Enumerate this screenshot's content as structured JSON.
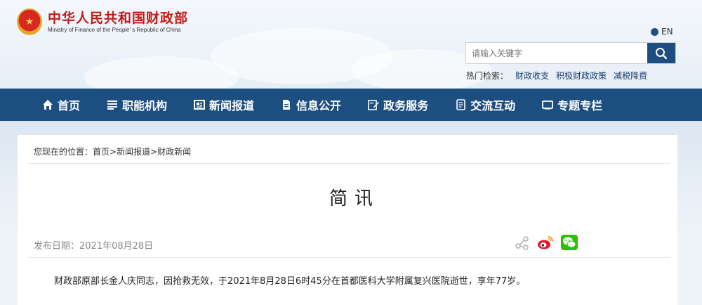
{
  "header": {
    "logo_cn": "中华人民共和国财政部",
    "logo_en": "Ministry of Finance of the People' s Republic of China",
    "lang_label": "EN",
    "search_placeholder": "请输入关键字",
    "hot_label": "热门检索：",
    "hot_links": [
      "财政收支",
      "积极财政政策",
      "减税降费"
    ]
  },
  "nav": {
    "items": [
      {
        "label": "首页",
        "icon": "home-icon"
      },
      {
        "label": "职能机构",
        "icon": "list-icon"
      },
      {
        "label": "新闻报道",
        "icon": "newspaper-icon"
      },
      {
        "label": "信息公开",
        "icon": "document-icon"
      },
      {
        "label": "政务服务",
        "icon": "edit-icon"
      },
      {
        "label": "交流互动",
        "icon": "notes-icon"
      },
      {
        "label": "专题专栏",
        "icon": "window-icon"
      }
    ]
  },
  "breadcrumb": "您现在的位置：首页>新闻报道>财政新闻",
  "article": {
    "title": "简讯",
    "date": "发布日期：2021年08月28日",
    "body": "财政部原部长金人庆同志，因抢救无效，于2021年8月28日6时45分在首都医科大学附属复兴医院逝世，享年77岁。"
  },
  "share_icons": [
    "share-icon",
    "weibo-icon",
    "wechat-icon"
  ],
  "colors": {
    "nav_bg": "#1c4e80",
    "logo_red": "#c11b17"
  }
}
